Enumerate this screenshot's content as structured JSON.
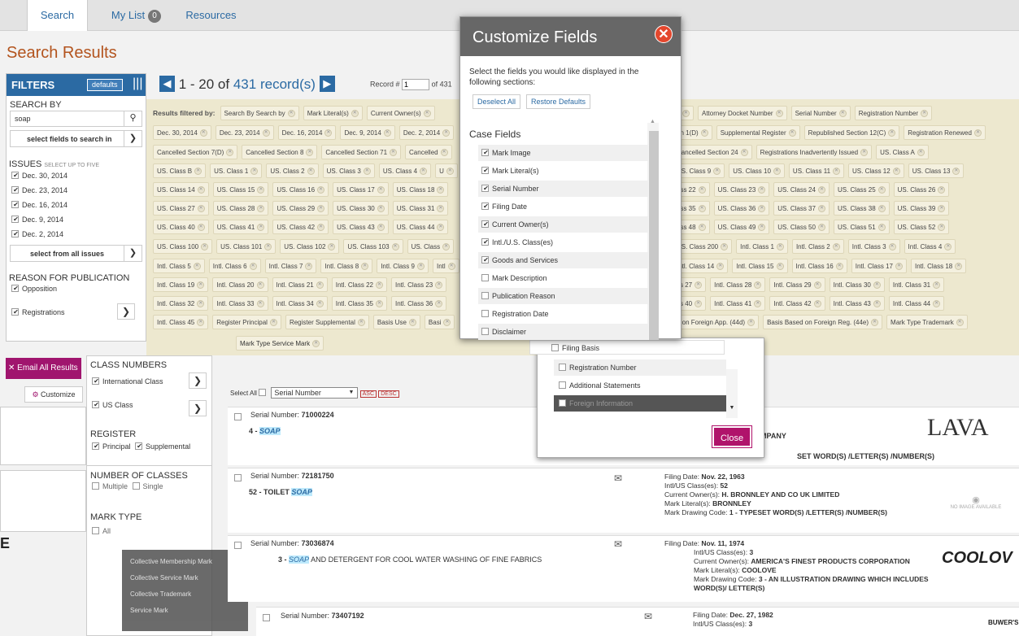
{
  "nav": {
    "tabs": [
      {
        "label": "Search"
      },
      {
        "label": "My List",
        "badge": "0"
      },
      {
        "label": "Resources"
      }
    ]
  },
  "page_title": "Search Results",
  "pager": {
    "range": "1 - 20 of",
    "count": "431",
    "suffix": "record(s)",
    "record_label": "Record #",
    "record_value": "1",
    "of_label": "of 431"
  },
  "filters": {
    "title": "FILTERS",
    "defaults_label": "defaults",
    "search_by_label": "SEARCH BY",
    "search_value": "soap",
    "select_fields_label": "select fields to search in",
    "issues_label": "ISSUES",
    "issues_hint": "SELECT UP TO FIVE",
    "issues": [
      "Dec. 30, 2014",
      "Dec. 23, 2014",
      "Dec. 16, 2014",
      "Dec. 9, 2014",
      "Dec. 2, 2014"
    ],
    "select_all_issues_label": "select from all issues",
    "reason_label": "REASON FOR PUBLICATION",
    "reasons": [
      "Opposition",
      "Registrations"
    ]
  },
  "left_panel": {
    "email_label": "Email All Results",
    "customize_label": "Customize",
    "class_numbers_label": "CLASS NUMBERS",
    "class_options": [
      "International Class",
      "US Class"
    ],
    "register_label": "REGISTER",
    "register_options": [
      "Principal",
      "Supplemental"
    ],
    "number_of_classes_label": "NUMBER OF CLASSES",
    "number_options": [
      "Multiple",
      "Single"
    ],
    "mark_type_label": "MARK TYPE",
    "mark_type_all": "All"
  },
  "filtered_by_label": "Results filtered by:",
  "chip_rows": [
    [
      "Search By Search by",
      "Mark Literal(s)",
      "Current Owner(s)"
    ],
    [
      "Dec. 30, 2014",
      "Dec. 23, 2014",
      "Dec. 16, 2014",
      "Dec. 9, 2014",
      "Dec. 2, 2014"
    ],
    [
      "Cancelled Section 7(D)",
      "Cancelled Section 8",
      "Cancelled Section 71",
      "Cancelled"
    ],
    [
      "US. Class B",
      "US. Class 1",
      "US. Class 2",
      "US. Class 3",
      "US. Class 4",
      "U"
    ],
    [
      "US. Class 14",
      "US. Class 15",
      "US. Class 16",
      "US. Class 17",
      "US. Class 18"
    ],
    [
      "US. Class 27",
      "US. Class 28",
      "US. Class 29",
      "US. Class 30",
      "US. Class 31"
    ],
    [
      "US. Class 40",
      "US. Class 41",
      "US. Class 42",
      "US. Class 43",
      "US. Class 44"
    ],
    [
      "US. Class 100",
      "US. Class 101",
      "US. Class 102",
      "US. Class 103",
      "US. Class"
    ],
    [
      "Intl. Class 5",
      "Intl. Class 6",
      "Intl. Class 7",
      "Intl. Class 8",
      "Intl. Class 9",
      "Intl"
    ],
    [
      "Intl. Class 19",
      "Intl. Class 20",
      "Intl. Class 21",
      "Intl. Class 22",
      "Intl. Class 23"
    ],
    [
      "Intl. Class 32",
      "Intl. Class 33",
      "Intl. Class 34",
      "Intl. Class 35",
      "Intl. Class 36"
    ],
    [
      "Intl. Class 45",
      "Register Principal",
      "Register Supplemental",
      "Basis Use",
      "Basi"
    ]
  ],
  "chip_rows_right": [
    [
      "s",
      "Attorney Docket Number",
      "Serial Number",
      "Registration Number"
    ],
    [
      "on 1(D)",
      "Supplemental Register",
      "Republished Section 12(C)",
      "Registration Renewed"
    ],
    [
      "Cancelled Section 24",
      "Registrations Inadvertently Issued",
      "US. Class A"
    ],
    [
      "US. Class 9",
      "US. Class 10",
      "US. Class 11",
      "US. Class 12",
      "US. Class 13"
    ],
    [
      "ass 22",
      "US. Class 23",
      "US. Class 24",
      "US. Class 25",
      "US. Class 26"
    ],
    [
      "ass 35",
      "US. Class 36",
      "US. Class 37",
      "US. Class 38",
      "US. Class 39"
    ],
    [
      "ass 48",
      "US. Class 49",
      "US. Class 50",
      "US. Class 51",
      "US. Class 52"
    ],
    [
      "US. Class 200",
      "Intl. Class 1",
      "Intl. Class 2",
      "Intl. Class 3",
      "Intl. Class 4"
    ],
    [
      "Intl. Class 14",
      "Intl. Class 15",
      "Intl. Class 16",
      "Intl. Class 17",
      "Intl. Class 18"
    ],
    [
      "ss 27",
      "Intl. Class 28",
      "Intl. Class 29",
      "Intl. Class 30",
      "Intl. Class 31"
    ],
    [
      "ss 40",
      "Intl. Class 41",
      "Intl. Class 42",
      "Intl. Class 43",
      "Intl. Class 44"
    ],
    [
      "d on Foreign App. (44d)",
      "Basis Based on Foreign Reg. (44e)",
      "Mark Type Trademark"
    ]
  ],
  "mark_type_service_chip": "Mark Type Service Mark",
  "sort": {
    "select_all_label": "Select All",
    "field": "Serial Number",
    "asc": "ASC",
    "desc": "DESC"
  },
  "records": [
    {
      "serial_label": "Serial Number:",
      "serial": "71000224",
      "goods_prefix": "4 -",
      "goods_hl": "SOAP",
      "goods_rest": "",
      "owner_tail": "MPANY",
      "drawing_tail": "SET WORD(S) /LETTER(S) /NUMBER(S)",
      "logo": "LAVA"
    },
    {
      "serial_label": "Serial Number:",
      "serial": "72181750",
      "goods_prefix": "52 - TOILET",
      "goods_hl": "SOAP",
      "goods_rest": "",
      "filing_label": "Filing Date:",
      "filing": "Nov. 22, 1963",
      "class_label": "Intl/US Class(es):",
      "classes": "52",
      "owner_label": "Current Owner(s):",
      "owner": "H. BRONNLEY AND CO UK LIMITED",
      "literal_label": "Mark Literal(s):",
      "literal": "BRONNLEY",
      "drawing_label": "Mark Drawing Code:",
      "drawing": "1 - TYPESET WORD(S) /LETTER(S) /NUMBER(S)",
      "no_image": "NO IMAGE AVAILABLE"
    },
    {
      "serial_label": "Serial Number:",
      "serial": "73036874",
      "goods_prefix": "3 -",
      "goods_hl": "SOAP",
      "goods_rest": "AND DETERGENT FOR COOL WATER WASHING OF FINE FABRICS",
      "filing_label": "Filing Date:",
      "filing": "Nov. 11, 1974",
      "class_label": "Intl/US Class(es):",
      "classes": "3",
      "owner_label": "Current Owner(s):",
      "owner": "AMERICA'S FINEST PRODUCTS CORPORATION",
      "literal_label": "Mark Literal(s):",
      "literal": "COOLOVE",
      "drawing_label": "Mark Drawing Code:",
      "drawing": "3 - AN ILLUSTRATION DRAWING WHICH INCLUDES WORD(S)/ LETTER(S)",
      "logo": "COOLOV"
    },
    {
      "serial_label": "Serial Number:",
      "serial": "73407192",
      "filing_label": "Filing Date:",
      "filing": "Dec. 27, 1982",
      "class_label": "Intl/US Class(es):",
      "classes": "3",
      "logo": "BUWER'S"
    }
  ],
  "mark_type_extra": [
    "Collective Membership Mark",
    "Collective Service Mark",
    "Collective Trademark",
    "Service Mark"
  ],
  "dialog": {
    "title": "Customize Fields",
    "instructions": "Select the fields you would like displayed in the following sections:",
    "deselect_label": "Deselect All",
    "restore_label": "Restore Defaults",
    "section_label": "Case Fields",
    "fields": [
      {
        "label": "Mark Image",
        "checked": true
      },
      {
        "label": "Mark Literal(s)",
        "checked": true
      },
      {
        "label": "Serial Number",
        "checked": true
      },
      {
        "label": "Filing Date",
        "checked": true
      },
      {
        "label": "Current Owner(s)",
        "checked": true
      },
      {
        "label": "Intl./U.S. Class(es)",
        "checked": true
      },
      {
        "label": "Goods and Services",
        "checked": true
      },
      {
        "label": "Mark Description",
        "checked": false
      },
      {
        "label": "Publication Reason",
        "checked": false
      },
      {
        "label": "Registration Date",
        "checked": false
      },
      {
        "label": "Disclaimer",
        "checked": false
      }
    ],
    "lower_fields": [
      "Filing Basis",
      "Registration Number",
      "Additional Statements",
      "Foreign Information"
    ],
    "close_label": "Close"
  },
  "colors": {
    "accent_blue": "#2b6aa3",
    "title_orange": "#b3541e",
    "close_magenta": "#b0136b",
    "close_red": "#e4472d",
    "filter_band": "#ede8cf"
  }
}
